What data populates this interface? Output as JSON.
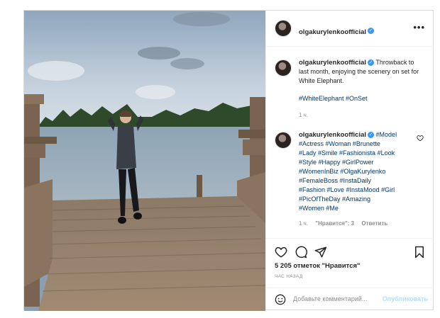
{
  "post": {
    "username": "olgakurylenkoofficial",
    "caption": {
      "text": "Throwback to last month, enjoying the scenery on set for White Elephant.",
      "tags": "#WhiteElephant #OnSet",
      "time": "1 ч."
    },
    "comment": {
      "line1": "#Model",
      "lines": [
        "#Actress #Woman #Brunette",
        "#Lady #Smile #Fashionista #Look",
        "#Style #Happy #GirlPower",
        "#WomenInBiz #OlgaKurylenko",
        "#FemaleBoss #InstaDaily",
        "#Fashion #Love #InstaMood #Girl",
        "#PicOfTheDay #Amazing",
        "#Women #Me"
      ],
      "time": "1 ч.",
      "likes": "\"Нравится\": 3",
      "reply": "Ответить"
    },
    "likes_count": "5 205 отметок \"Нравится\"",
    "timestamp": "ЧАС НАЗАД",
    "add_comment_placeholder": "Добавьте комментарий...",
    "publish_label": "Опубликовать"
  },
  "colors": {
    "link": "#00376b",
    "verified": "#3897f0",
    "publish": "#b2dffc"
  },
  "icons": [
    "more-icon",
    "heart-icon",
    "comment-icon",
    "share-icon",
    "bookmark-icon",
    "emoji-icon",
    "verified-icon"
  ]
}
